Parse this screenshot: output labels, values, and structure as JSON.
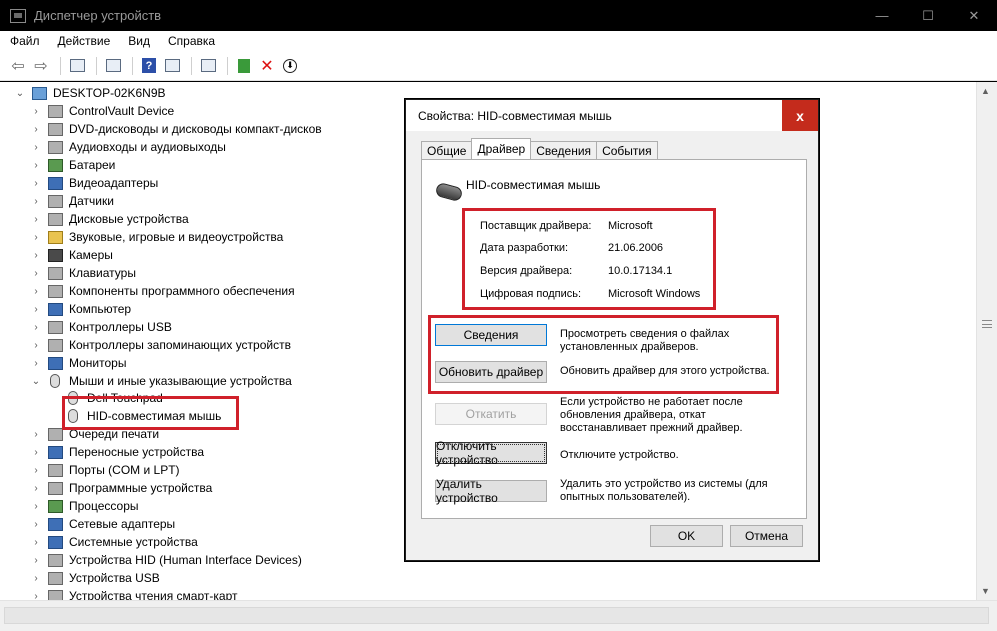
{
  "window": {
    "title": "Диспетчер устройств",
    "controls": [
      "—",
      "☐",
      "✕"
    ]
  },
  "menu": [
    "Файл",
    "Действие",
    "Вид",
    "Справка"
  ],
  "tree": {
    "root": "DESKTOP-02K6N9B",
    "items": [
      "ControlVault Device",
      "DVD-дисководы и дисководы компакт-дисков",
      "Аудиовходы и аудиовыходы",
      "Батареи",
      "Видеоадаптеры",
      "Датчики",
      "Дисковые устройства",
      "Звуковые, игровые и видеоустройства",
      "Камеры",
      "Клавиатуры",
      "Компоненты программного обеспечения",
      "Компьютер",
      "Контроллеры USB",
      "Контроллеры запоминающих устройств",
      "Мониторы",
      "Мыши и иные указывающие устройства"
    ],
    "children": [
      "Dell Touchpad",
      "HID-совместимая мышь"
    ],
    "after": [
      "Очереди печати",
      "Переносные устройства",
      "Порты (COM и LPT)",
      "Программные устройства",
      "Процессоры",
      "Сетевые адаптеры",
      "Системные устройства",
      "Устройства HID (Human Interface Devices)",
      "Устройства USB",
      "Устройства чтения смарт-карт"
    ]
  },
  "dialog": {
    "title": "Свойства: HID-совместимая мышь",
    "close": "x",
    "tabs": [
      "Общие",
      "Драйвер",
      "Сведения",
      "События"
    ],
    "device_name": "HID-совместимая мышь",
    "info": {
      "provider_label": "Поставщик драйвера:",
      "provider_value": "Microsoft",
      "date_label": "Дата разработки:",
      "date_value": "21.06.2006",
      "version_label": "Версия драйвера:",
      "version_value": "10.0.17134.1",
      "signature_label": "Цифровая подпись:",
      "signature_value": "Microsoft Windows"
    },
    "buttons": {
      "details": "Сведения",
      "details_desc": "Просмотреть сведения о файлах установленных драйверов.",
      "update": "Обновить драйвер",
      "update_desc": "Обновить драйвер для этого устройства.",
      "rollback": "Откатить",
      "rollback_desc": "Если устройство не работает после обновления драйвера, откат восстанавливает прежний драйвер.",
      "disable": "Отключить устройство",
      "disable_desc": "Отключите устройство.",
      "uninstall": "Удалить устройство",
      "uninstall_desc": "Удалить это устройство из системы (для опытных пользователей).",
      "ok": "OK",
      "cancel": "Отмена"
    }
  },
  "colors": {
    "highlight_red": "#d0202a",
    "close_red": "#c42b1c",
    "focus_blue": "#0078d7"
  }
}
